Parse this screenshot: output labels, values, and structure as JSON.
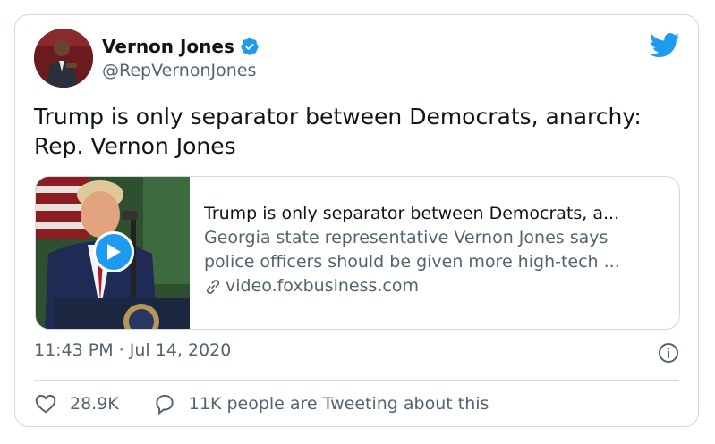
{
  "author": {
    "display_name": "Vernon Jones",
    "handle": "@RepVernonJones",
    "verified": true
  },
  "tweet": {
    "text": "Trump is only separator between Democrats, anarchy: Rep. Vernon Jones",
    "timestamp": "11:43 PM · Jul 14, 2020"
  },
  "card": {
    "title": "Trump is only separator between Democrats, a...",
    "description": "Georgia state representative Vernon Jones says police officers should be given more high-tech ...",
    "domain": "video.foxbusiness.com",
    "has_video": true
  },
  "engagement": {
    "likes": "28.9K",
    "tweeting": "11K people are Tweeting about this"
  },
  "colors": {
    "brand_blue": "#1d9bf0",
    "text_primary": "#0f1419",
    "text_secondary": "#536471",
    "border": "#cfd9de"
  }
}
